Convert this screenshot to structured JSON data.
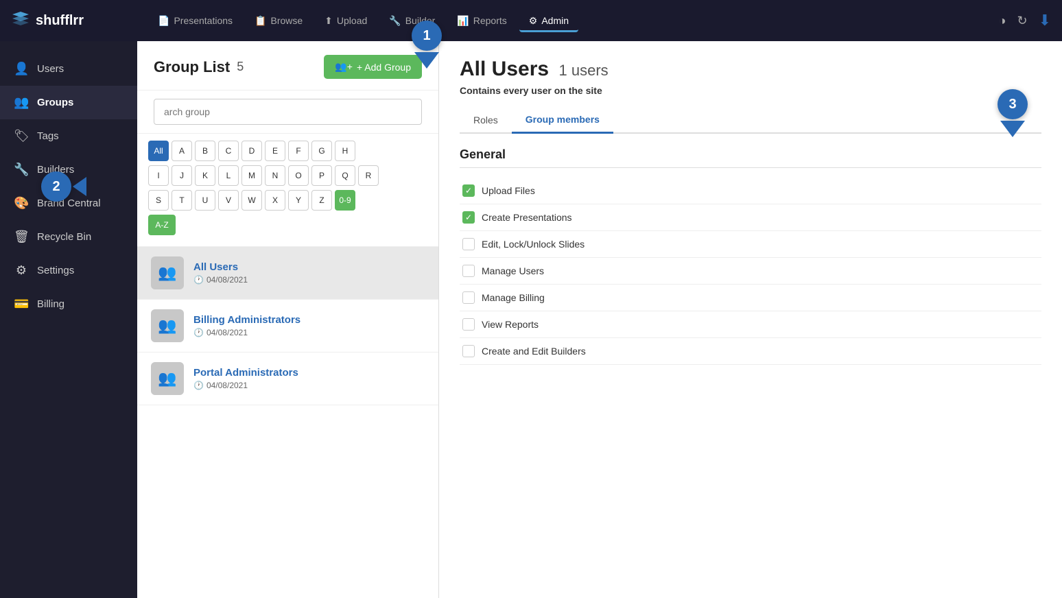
{
  "app": {
    "logo": "shufflrr",
    "logo_icon": "≡"
  },
  "topnav": {
    "items": [
      {
        "label": "Presentations",
        "icon": "📄",
        "active": false
      },
      {
        "label": "Browse",
        "icon": "📋",
        "active": false
      },
      {
        "label": "Upload",
        "icon": "⬆",
        "active": false
      },
      {
        "label": "Builder",
        "icon": "🔧",
        "active": false
      },
      {
        "label": "Reports",
        "icon": "📊",
        "active": false
      },
      {
        "label": "Admin",
        "icon": "⚙",
        "active": true
      }
    ]
  },
  "sidebar": {
    "items": [
      {
        "label": "Users",
        "icon": "👤",
        "active": false
      },
      {
        "label": "Groups",
        "icon": "👥",
        "active": true
      },
      {
        "label": "Tags",
        "icon": "🏷",
        "active": false
      },
      {
        "label": "Builders",
        "icon": "🔧",
        "active": false
      },
      {
        "label": "Brand Central",
        "icon": "🎨",
        "active": false
      },
      {
        "label": "Recycle Bin",
        "icon": "🗑",
        "active": false
      },
      {
        "label": "Settings",
        "icon": "⚙",
        "active": false
      },
      {
        "label": "Billing",
        "icon": "💳",
        "active": false
      }
    ]
  },
  "group_list": {
    "title": "Group List",
    "count": "5",
    "search_placeholder": "arch group",
    "add_button": "+ Add Group",
    "alpha_row1": [
      "All",
      "A",
      "B",
      "C",
      "D",
      "E",
      "F",
      "G",
      "H"
    ],
    "alpha_row2": [
      "I",
      "J",
      "K",
      "L",
      "M",
      "N",
      "O",
      "P",
      "Q",
      "R"
    ],
    "alpha_row3": [
      "S",
      "T",
      "U",
      "V",
      "W",
      "X",
      "Y",
      "Z",
      "0-9"
    ],
    "az_label": "A-Z",
    "groups": [
      {
        "name": "All Users",
        "created": "04/08/2021",
        "selected": true
      },
      {
        "name": "Billing Administrators",
        "created": "04/08/2021",
        "selected": false
      },
      {
        "name": "Portal Administrators",
        "created": "04/08/2021",
        "selected": false
      }
    ]
  },
  "detail": {
    "title": "All Users",
    "user_count": "1 users",
    "subtitle": "Contains every user on the site",
    "tabs": [
      "Roles",
      "Group members"
    ],
    "active_tab": "Group members",
    "section_title": "General",
    "roles": [
      {
        "label": "Upload Files",
        "checked": true
      },
      {
        "label": "Create Presentations",
        "checked": true
      },
      {
        "label": "Edit, Lock/Unlock Slides",
        "checked": false
      },
      {
        "label": "Manage Users",
        "checked": false
      },
      {
        "label": "Manage Billing",
        "checked": false
      },
      {
        "label": "View Reports",
        "checked": false
      },
      {
        "label": "Create and Edit Builders",
        "checked": false
      }
    ]
  },
  "annotations": {
    "badge1": "1",
    "badge2": "2",
    "badge3": "3"
  }
}
